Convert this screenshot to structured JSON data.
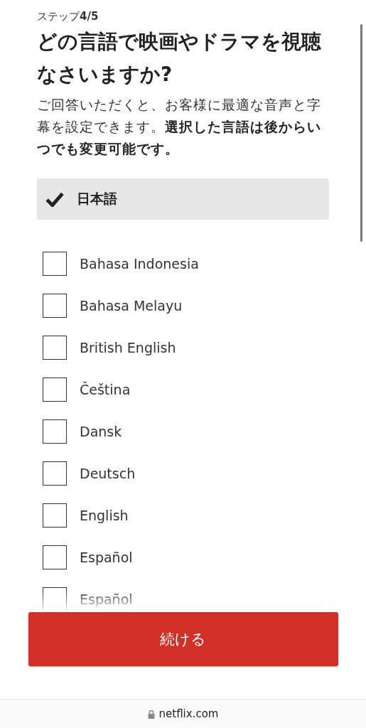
{
  "step": "ステップ**4/5**",
  "heading": "どの言語で映画やドラマを視聴なさいますか?",
  "description": "ご回答いただくと、お客様に最適な音声と字幕を設定できます。**選択した言語は後からいつでも変更可能です。**",
  "selected_language": {
    "label": "日本語",
    "checked": true
  },
  "languages": [
    {
      "label": "Bahasa Indonesia",
      "checked": false
    },
    {
      "label": "Bahasa Melayu",
      "checked": false
    },
    {
      "label": "British English",
      "checked": false
    },
    {
      "label": "Čeština",
      "checked": false
    },
    {
      "label": "Dansk",
      "checked": false
    },
    {
      "label": "Deutsch",
      "checked": false
    },
    {
      "label": "English",
      "checked": false
    },
    {
      "label": "Español",
      "checked": false
    },
    {
      "label": "Español",
      "checked": false
    }
  ],
  "continue_button": "続ける",
  "address_bar": {
    "url": "netflix.com"
  }
}
